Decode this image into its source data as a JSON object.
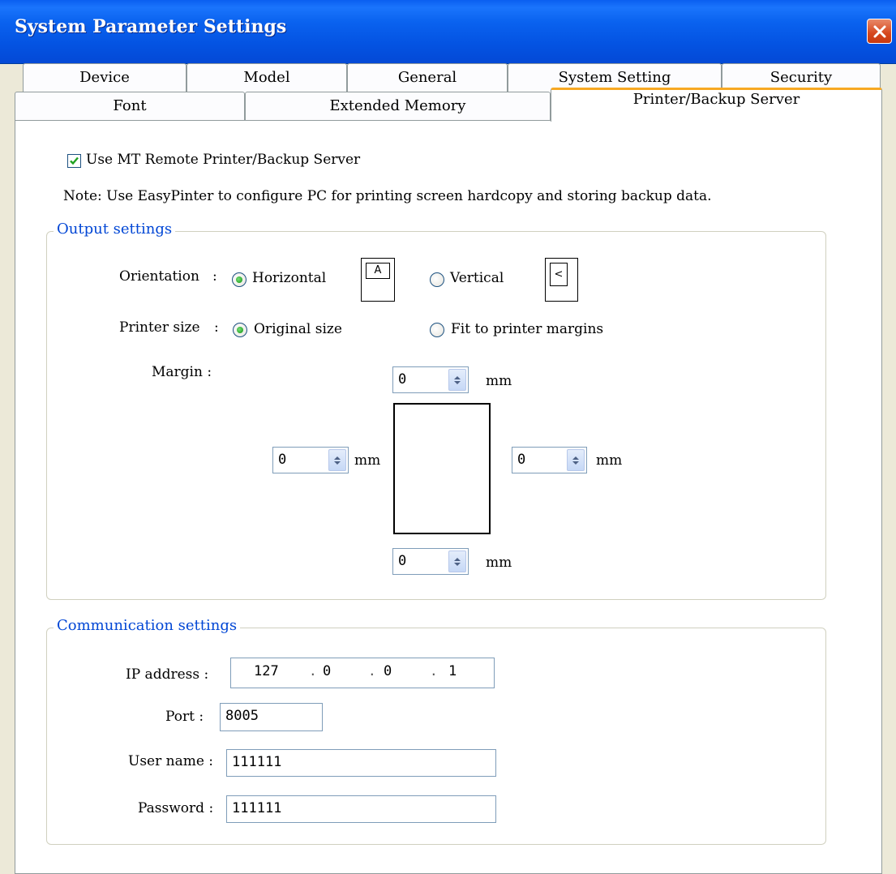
{
  "window": {
    "title": "System Parameter Settings"
  },
  "tabs": {
    "row1": [
      "Device",
      "Model",
      "General",
      "System Setting",
      "Security"
    ],
    "row2": [
      "Font",
      "Extended Memory",
      "Printer/Backup Server"
    ],
    "active": "Printer/Backup Server"
  },
  "use_remote": {
    "label": "Use MT Remote Printer/Backup Server",
    "checked": true
  },
  "note": "Note: Use EasyPinter to configure PC for printing screen hardcopy and storing backup data.",
  "output": {
    "legend": "Output settings",
    "orientation": {
      "label": "Orientation",
      "colon": ":",
      "options": [
        "Horizontal",
        "Vertical"
      ],
      "selected": "Horizontal",
      "horizontal_icon_glyph": "A",
      "vertical_icon_glyph": "<"
    },
    "printer_size": {
      "label": "Printer size",
      "colon": ":",
      "options": [
        "Original size",
        "Fit to printer margins"
      ],
      "selected": "Original size"
    },
    "margin": {
      "label": "Margin :",
      "unit": "mm",
      "top": "0",
      "left": "0",
      "right": "0",
      "bottom": "0"
    }
  },
  "communication": {
    "legend": "Communication settings",
    "ip_label": "IP address :",
    "ip": [
      "127",
      "0",
      "0",
      "1"
    ],
    "port_label": "Port :",
    "port": "8005",
    "user_label": "User name :",
    "user": "111111",
    "password_label": "Password :",
    "password": "111111"
  }
}
